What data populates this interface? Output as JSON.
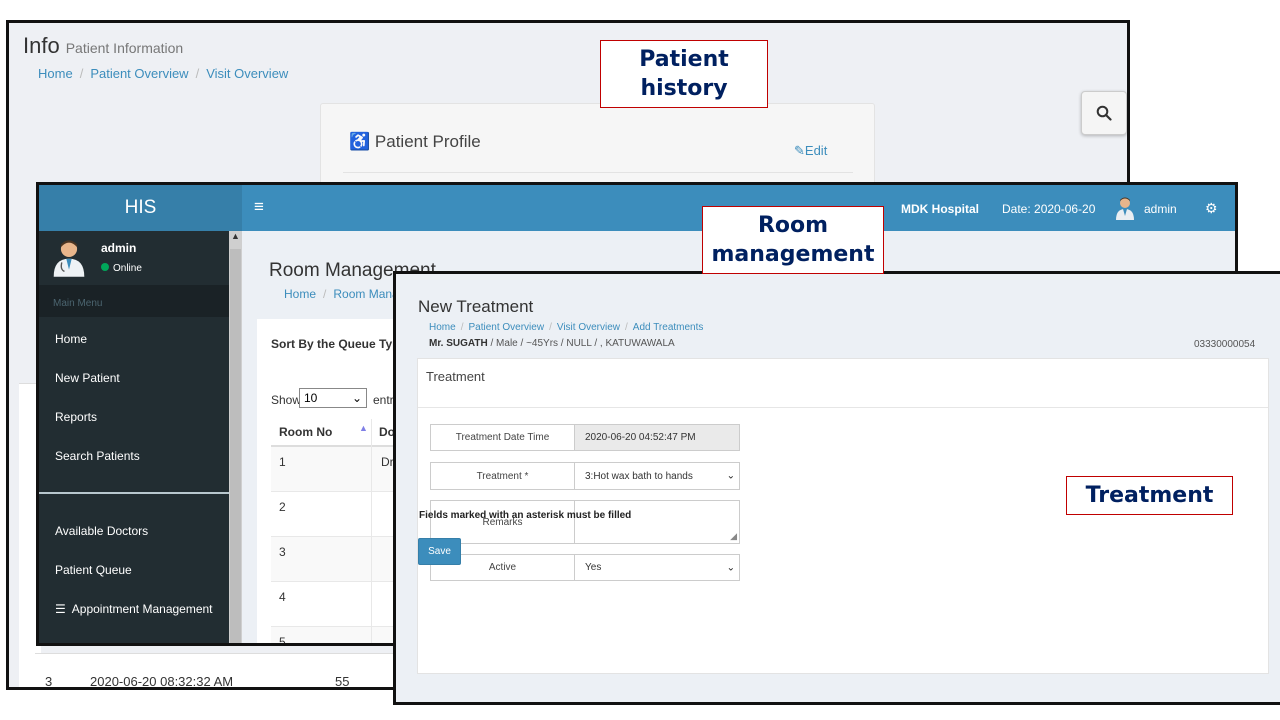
{
  "patient_history": {
    "title": "Info",
    "subtitle": "Patient Information",
    "breadcrumb": [
      "Home",
      "Patient Overview",
      "Visit Overview"
    ],
    "profile_title": "Patient Profile",
    "edit_label": "Edit",
    "bottom_row": {
      "index": "3",
      "datetime": "2020-06-20 08:32:32 AM",
      "value": "55"
    }
  },
  "room_management": {
    "logo": "HIS",
    "hospital": "MDK Hospital",
    "date": "Date: 2020-06-20",
    "user": "admin",
    "sidebar_user": "admin",
    "status": "Online",
    "main_menu": "Main Menu",
    "menu_items": [
      "Home",
      "New Patient",
      "Reports",
      "Search Patients"
    ],
    "menu_items_lower": [
      "Available Doctors",
      "Patient Queue",
      "Appointment Management"
    ],
    "page_title": "Room Management",
    "breadcrumb": [
      "Home",
      "Room Management"
    ],
    "sort_label": "Sort By the Queue Type",
    "show_label": "Show",
    "entries_label": "entries",
    "page_size": "10",
    "columns": [
      "Room No",
      "Doctor"
    ],
    "rows": [
      {
        "room": "1",
        "doctor": "Dr."
      },
      {
        "room": "2",
        "doctor": ""
      },
      {
        "room": "3",
        "doctor": ""
      },
      {
        "room": "4",
        "doctor": ""
      },
      {
        "room": "5",
        "doctor": ""
      }
    ]
  },
  "treatment": {
    "title": "New Treatment",
    "breadcrumb": [
      "Home",
      "Patient Overview",
      "Visit Overview",
      "Add Treatments"
    ],
    "patient_name": "Mr. SUGATH",
    "patient_details": " / Male / ~45Yrs / NULL / , KATUWAWALA",
    "patient_id": "03330000054",
    "panel_title": "Treatment",
    "fields": {
      "date_label": "Treatment Date Time",
      "date_value": "2020-06-20 04:52:47 PM",
      "treatment_label": "Treatment *",
      "treatment_value": "3:Hot wax bath to hands",
      "remarks_label": "Remarks",
      "remarks_value": "",
      "active_label": "Active",
      "active_value": "Yes"
    },
    "required_note": "Fields marked with an asterisk must be filled",
    "save_label": "Save"
  },
  "annotations": {
    "history": [
      "Patient",
      "history"
    ],
    "room": [
      "Room",
      "management"
    ],
    "treatment": "Treatment"
  },
  "colors": {
    "header_blue": "#3c8dbc",
    "logo_blue": "#367fa9",
    "sidebar_dark": "#222d32",
    "annotation_text": "#002060",
    "annotation_border": "#c00000"
  }
}
